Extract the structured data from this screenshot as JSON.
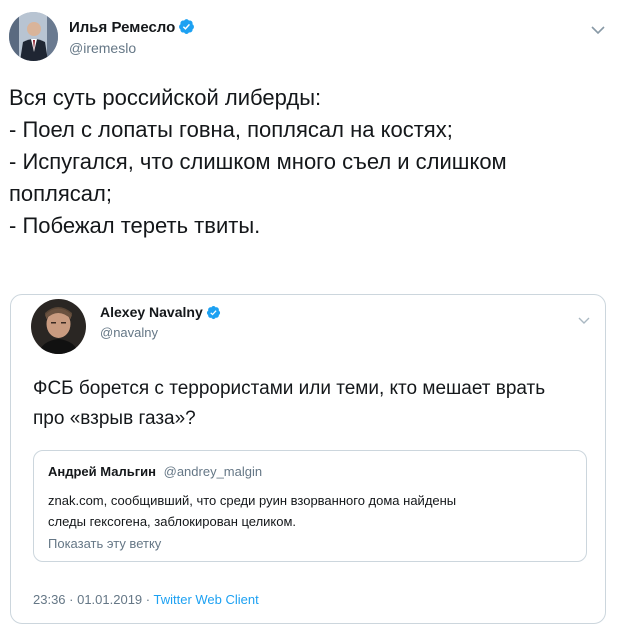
{
  "main_tweet": {
    "author_name": "Илья Ремесло",
    "author_handle": "@iremeslo",
    "verified": true,
    "text_lines": [
      "Вся суть российской либерды:",
      "",
      "- Поел с лопаты говна, поплясал на костях;",
      "- Испугался, что слишком много съел и слишком",
      "поплясал;",
      "- Побежал тереть твиты."
    ]
  },
  "quoted_tweet": {
    "author_name": "Alexey Navalny",
    "author_handle": "@navalny",
    "verified": true,
    "text_lines": [
      "ФСБ борется с террористами или теми, кто мешает врать",
      "про «взрыв газа»?"
    ],
    "timestamp": "23:36 · 01.01.2019 ·",
    "client": "Twitter Web Client"
  },
  "nested_quote": {
    "author_name": "Андрей Мальгин",
    "author_handle": "@andrey_malgin",
    "text_lines": [
      "znak.com, сообщивший, что среди руин взорванного дома найдены",
      "следы гексогена, заблокирован целиком."
    ],
    "show_thread_label": "Показать эту ветку"
  },
  "colors": {
    "text": "#14171a",
    "secondary": "#657786",
    "link": "#1da1f2",
    "border": "#ccd6dd",
    "verified": "#1da1f2"
  },
  "icons": {
    "menu": "chevron-down-icon",
    "badge": "verified-badge-icon"
  }
}
